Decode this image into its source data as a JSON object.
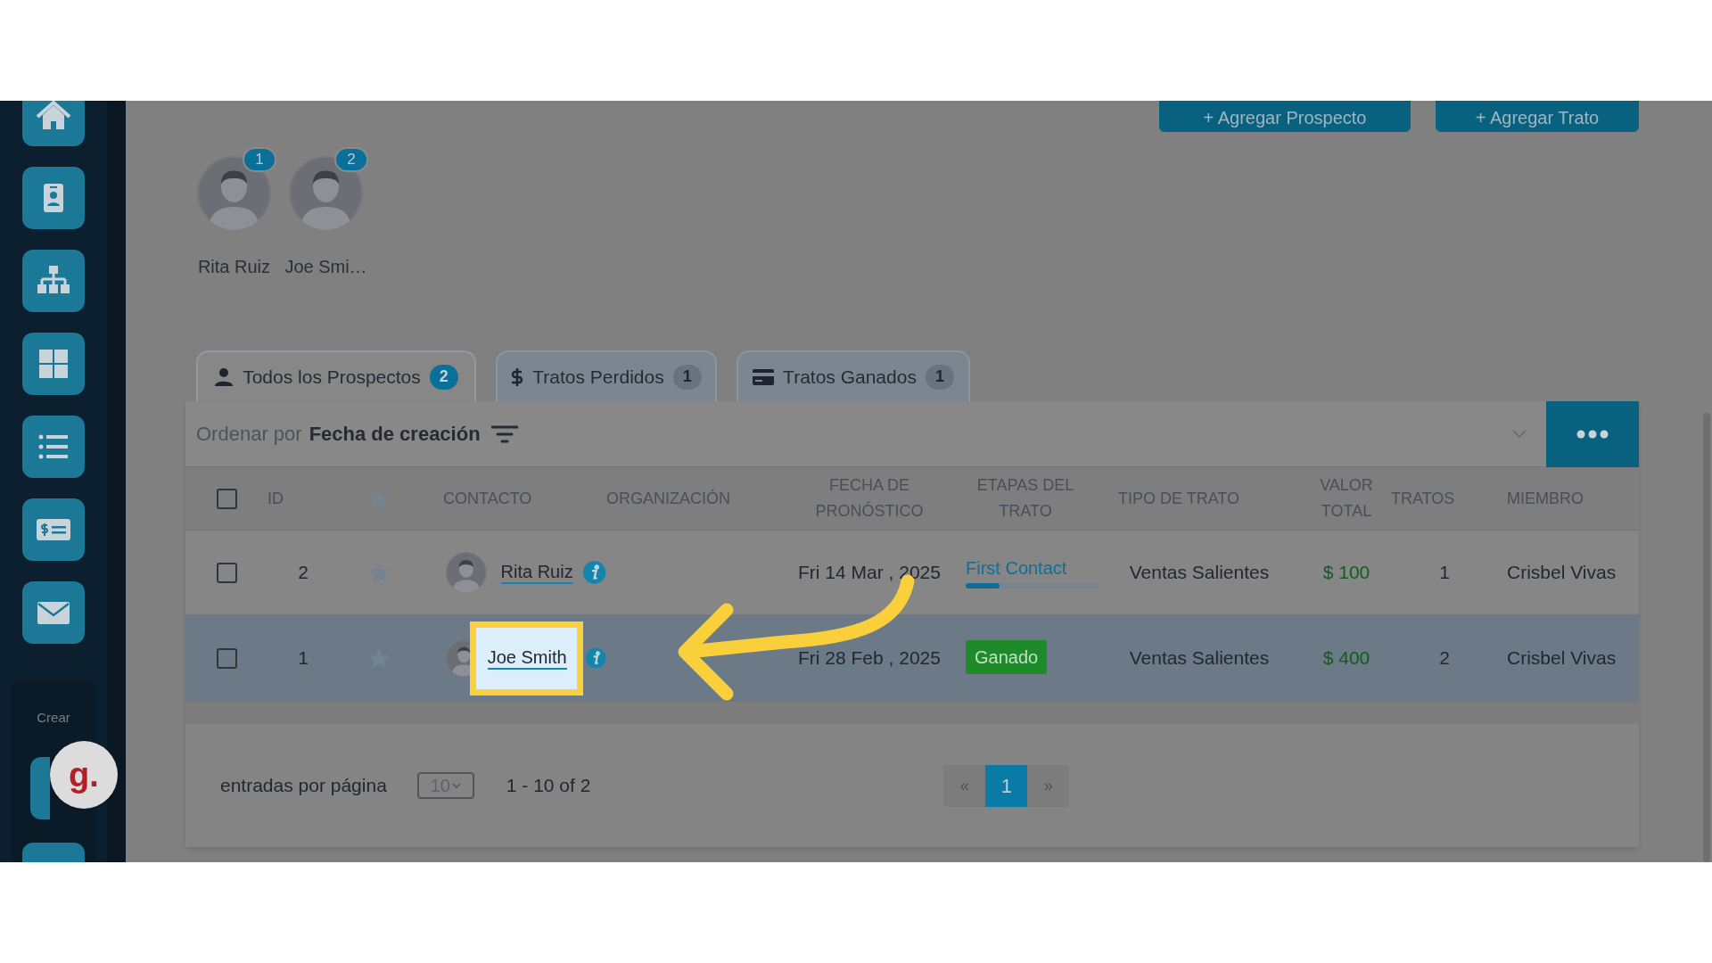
{
  "sidebar": {
    "section_label": "Crear"
  },
  "help_widget": {
    "label": "g."
  },
  "header_buttons": [
    "+ Agregar Prospecto",
    "+ Agregar Trato"
  ],
  "assignees": [
    {
      "name": "Rita Ruiz",
      "badge": "1"
    },
    {
      "name": "Joe Smi…",
      "badge": "2"
    }
  ],
  "tabs": [
    {
      "label": "Todos los Prospectos",
      "count": "2",
      "selected": true
    },
    {
      "label": "Tratos Perdidos",
      "count": "1",
      "selected": false
    },
    {
      "label": "Tratos Ganados",
      "count": "1",
      "selected": false
    }
  ],
  "sort": {
    "label": "Ordenar por",
    "value": "Fecha de creación"
  },
  "table": {
    "select_all_checked": false,
    "columns": [
      "ID",
      "CONTACTO",
      "ORGANIZACIÓN",
      "FECHA DE PRONÓSTICO",
      "ETAPAS DEL TRATO",
      "TIPO DE TRATO",
      "VALOR TOTAL",
      "TRATOS",
      "MIEMBRO"
    ],
    "rows": [
      {
        "checked": false,
        "selected": false,
        "highlighted": false,
        "id": "2",
        "contact": "Rita Ruiz",
        "forecast_date": "Fri 14 Mar , 2025",
        "stage": {
          "kind": "progress",
          "label": "First Contact",
          "level": 0.25
        },
        "deal_type": "Ventas Salientes",
        "total": "$ 100",
        "deals": "1",
        "member": "Crisbel Vivas"
      },
      {
        "checked": false,
        "selected": true,
        "highlighted": true,
        "id": "1",
        "contact": "Joe Smith",
        "forecast_date": "Fri 28 Feb , 2025",
        "stage": {
          "kind": "badge",
          "label": "Ganado"
        },
        "deal_type": "Ventas Salientes",
        "total": "$ 400",
        "deals": "2",
        "member": "Crisbel Vivas"
      }
    ]
  },
  "footer": {
    "per_page_label": "entradas por página",
    "per_page": "10",
    "range": "1 - 10 of 2",
    "pages": [
      {
        "label": "«",
        "selected": false
      },
      {
        "label": "1",
        "selected": true
      },
      {
        "label": "»",
        "selected": false
      }
    ]
  }
}
